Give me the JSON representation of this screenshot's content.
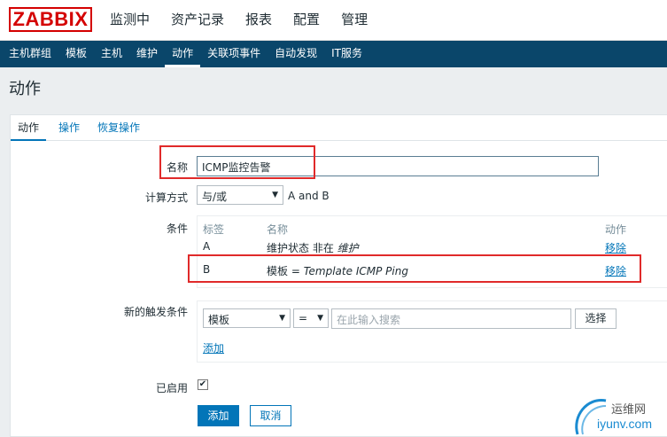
{
  "header": {
    "logo": "ZABBIX",
    "menu": [
      "监测中",
      "资产记录",
      "报表",
      "配置",
      "管理"
    ]
  },
  "submenu": [
    "主机群组",
    "模板",
    "主机",
    "维护",
    "动作",
    "关联项事件",
    "自动发现",
    "IT服务"
  ],
  "page_title": "动作",
  "tabs": [
    "动作",
    "操作",
    "恢复操作"
  ],
  "form": {
    "name_label": "名称",
    "name_value": "ICMP监控告警",
    "calc_label": "计算方式",
    "calc_value": "与/或",
    "calc_expr": "A and B",
    "conditions_label": "条件",
    "conditions_headers": [
      "标签",
      "名称",
      "动作"
    ],
    "conditions": [
      {
        "tag": "A",
        "name_prefix": "维护状态 非在 ",
        "name_value": "维护",
        "action": "移除"
      },
      {
        "tag": "B",
        "name_prefix": "模板 = ",
        "name_value": "Template ICMP Ping",
        "action": "移除"
      }
    ],
    "new_condition_label": "新的触发条件",
    "new_type": "模板",
    "new_operator": "=",
    "search_placeholder": "在此输入搜索",
    "select_button": "选择",
    "add_link": "添加",
    "enabled_label": "已启用",
    "enabled_mark": "✔",
    "add_button": "添加",
    "cancel_button": "取消"
  },
  "watermark": {
    "line1": "运维网",
    "line2": "iyunv.com"
  },
  "colors": {
    "brand": "#d40000",
    "nav": "#0a466a",
    "accent": "#0275b8",
    "highlight": "#e02a2a"
  }
}
